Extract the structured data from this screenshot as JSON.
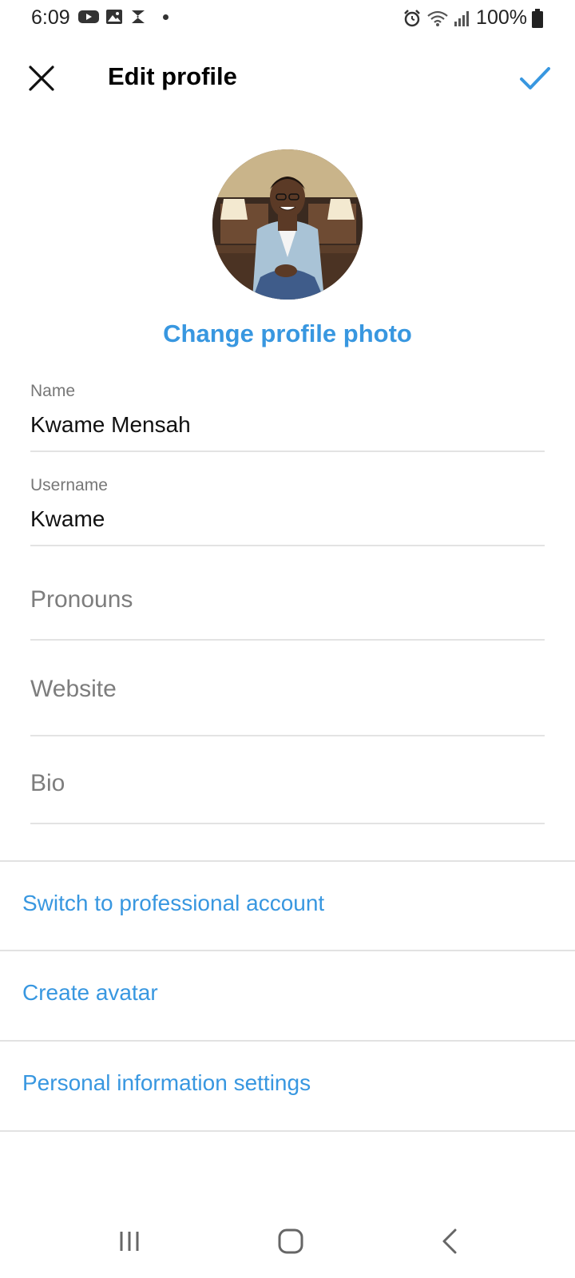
{
  "status_bar": {
    "time": "6:09",
    "battery": "100%",
    "left_icons": [
      "youtube-icon",
      "gallery-icon",
      "app-s-icon",
      "notification-dot"
    ],
    "right_icons": [
      "alarm-icon",
      "wifi-icon",
      "signal-icon",
      "battery-icon"
    ]
  },
  "header": {
    "title": "Edit profile",
    "close_icon": "close-icon",
    "done_icon": "checkmark-icon"
  },
  "profile": {
    "change_photo_label": "Change profile photo"
  },
  "fields": {
    "name": {
      "label": "Name",
      "value": "Kwame Mensah"
    },
    "username": {
      "label": "Username",
      "value": "Kwame"
    },
    "pronouns": {
      "placeholder": "Pronouns"
    },
    "website": {
      "placeholder": "Website"
    },
    "bio": {
      "placeholder": "Bio"
    }
  },
  "links": {
    "professional": "Switch to professional account",
    "avatar": "Create avatar",
    "personal_info": "Personal information settings"
  },
  "nav": {
    "items": [
      "recents-icon",
      "home-icon",
      "back-icon"
    ]
  },
  "colors": {
    "accent": "#3897e0",
    "divider": "#e2e2e2",
    "placeholder": "#7d7d7d"
  }
}
